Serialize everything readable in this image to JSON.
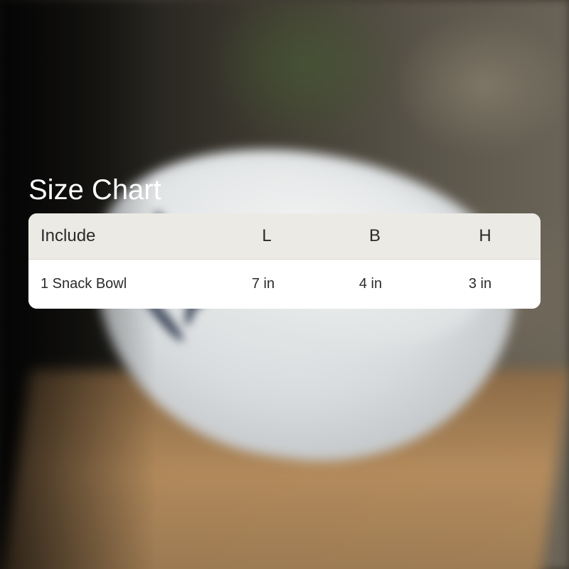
{
  "title": "Size Chart",
  "table": {
    "headers": [
      "Include",
      "L",
      "B",
      "H"
    ],
    "rows": [
      [
        "1 Snack Bowl",
        "7 in",
        "4 in",
        "3 in"
      ]
    ]
  },
  "colors": {
    "header_bg": "#eceae4",
    "body_bg": "#ffffff",
    "title_text": "#ffffff",
    "cell_text": "#2a2a2a"
  }
}
